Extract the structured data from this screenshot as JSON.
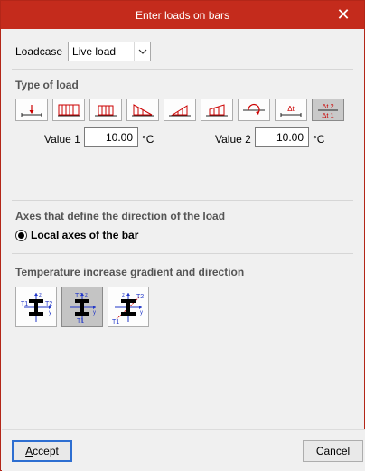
{
  "window": {
    "title": "Enter loads on bars",
    "close_glyph": "✕"
  },
  "loadcase": {
    "label": "Loadcase",
    "value": "Live load"
  },
  "type_of_load": {
    "title": "Type of load",
    "buttons": [
      {
        "icon": "point-load-icon",
        "active": false
      },
      {
        "icon": "uniform-load-icon",
        "active": false
      },
      {
        "icon": "partial-uniform-load-icon",
        "active": false
      },
      {
        "icon": "triangular-load-icon",
        "active": false
      },
      {
        "icon": "partial-triangular-load-icon",
        "active": false
      },
      {
        "icon": "trapezoidal-load-icon",
        "active": false
      },
      {
        "icon": "moment-load-icon",
        "active": false
      },
      {
        "icon": "temperature-increment-icon",
        "active": false
      },
      {
        "icon": "temperature-gradient-icon",
        "active": true
      }
    ],
    "btn_labels": {
      "at": "Δt",
      "at2": "Δt 2",
      "at1": "Δt 1"
    },
    "value1_label": "Value 1",
    "value1": "10.00",
    "value1_unit": "°C",
    "value2_label": "Value 2",
    "value2": "10.00",
    "value2_unit": "°C"
  },
  "axes": {
    "title": "Axes that define the direction of the load",
    "option_label": "Local axes of the bar"
  },
  "temperature": {
    "title": "Temperature increase gradient and direction",
    "buttons": [
      {
        "icon": "gradient-horizontal-icon",
        "active": false
      },
      {
        "icon": "gradient-vertical-icon",
        "active": true
      },
      {
        "icon": "gradient-diagonal-icon",
        "active": false
      }
    ],
    "glyph_labels": {
      "t1": "T1",
      "t2": "T2",
      "z": "z",
      "y": "y"
    }
  },
  "footer": {
    "accept_first": "A",
    "accept_rest": "ccept",
    "cancel": "Cancel"
  },
  "colors": {
    "titlebar": "#c42b1c",
    "accent_red": "#cc0000",
    "accent_blue": "#1f35c8",
    "focus_blue": "#2d6ed1"
  }
}
